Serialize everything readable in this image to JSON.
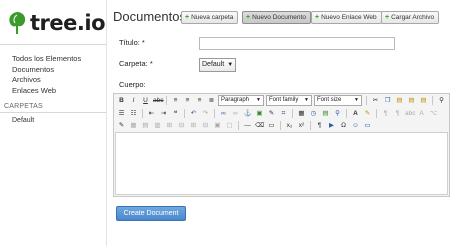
{
  "logo": {
    "name": "tree",
    "tld": ".io"
  },
  "sidebar": {
    "items": [
      {
        "label": "Todos los Elementos"
      },
      {
        "label": "Documentos"
      },
      {
        "label": "Archivos"
      },
      {
        "label": "Enlaces Web"
      }
    ],
    "folders_title": "CARPETAS",
    "folder_items": [
      {
        "label": "Default"
      }
    ]
  },
  "header": {
    "title": "Documentos",
    "buttons": [
      {
        "label": "Nueva carpeta"
      },
      {
        "label": "Nuevo Documento"
      },
      {
        "label": "Nuevo Enlace Web"
      },
      {
        "label": "Cargar Archivo"
      }
    ]
  },
  "form": {
    "title_label": "Título: *",
    "title_value": "",
    "folder_label": "Carpeta: *",
    "folder_value": "Default",
    "body_label": "Cuerpo:",
    "create_button": "Create Document"
  },
  "editor": {
    "format_dropdown": "Paragraph",
    "fontfamily_dropdown": "Font family",
    "fontsize_dropdown": "Font size"
  },
  "colors": {
    "accent": "#4a87cc",
    "logo_green": "#3a9a2a",
    "editor_bg": "#f4f4f4"
  }
}
